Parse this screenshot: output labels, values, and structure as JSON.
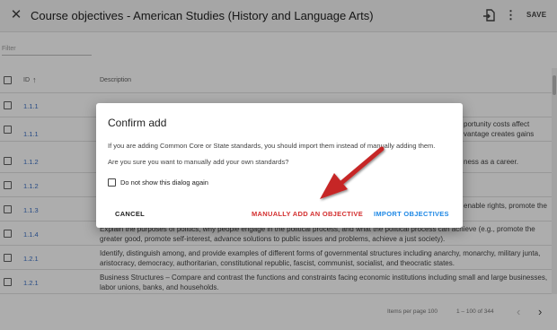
{
  "header": {
    "close_icon": "close-icon",
    "title": "Course objectives - American Studies (History and Language Arts)",
    "import_icon": "file-import-icon",
    "more_icon": "more-vert-icon",
    "more_glyph": "⋮",
    "close_glyph": "✕",
    "save_label": "SAVE"
  },
  "filter": {
    "placeholder": "Filter"
  },
  "table": {
    "columns": {
      "id": "ID",
      "description": "Description"
    },
    "sort_glyph": "↑",
    "rows": [
      {
        "id": "1.1.1",
        "description": ""
      },
      {
        "id": "1.1.1",
        "description": ""
      },
      {
        "id": "1.1.2",
        "description": ""
      },
      {
        "id": "1.1.2",
        "description": ""
      },
      {
        "id": "1.1.3",
        "description": ""
      },
      {
        "id": "1.1.4",
        "description": "Explain the purposes of politics, why people engage in the political process, and what the political process can achieve (e.g., promote the greater good, promote self-interest, advance solutions to public issues and problems, achieve a just society)."
      },
      {
        "id": "1.2.1",
        "description": "Identify, distinguish among, and provide examples of different forms of governmental structures including anarchy, monarchy, military junta, aristocracy, democracy, authoritarian, constitutional republic, fascist, communist, socialist, and theocratic states."
      },
      {
        "id": "1.2.1",
        "description": "Business Structures – Compare and contrast the functions and constraints facing economic institutions including small and large businesses, labor unions, banks, and households."
      }
    ],
    "partial_right_texts": [
      "portunity costs affect",
      "vantage creates gains",
      "ness as a career.",
      "enable rights, promote the"
    ]
  },
  "footer": {
    "items_per_page": "Items per page 100",
    "range": "1 – 100 of 344",
    "prev_glyph": "‹",
    "next_glyph": "›"
  },
  "dialog": {
    "title": "Confirm add",
    "line1": "If you are adding Common Core or State standards, you should import them instead of manually adding them.",
    "line2": "Are you sure you want to manually add your own standards?",
    "checkbox_label": "Do not show this dialog again",
    "cancel_label": "CANCEL",
    "manual_label": "MANUALLY ADD AN OBJECTIVE",
    "import_label": "IMPORT OBJECTIVES"
  },
  "colors": {
    "accent_blue": "#1e88e5",
    "danger_red": "#d32f2f",
    "arrow_red": "#c62828",
    "link_blue": "#3a6fc4"
  }
}
